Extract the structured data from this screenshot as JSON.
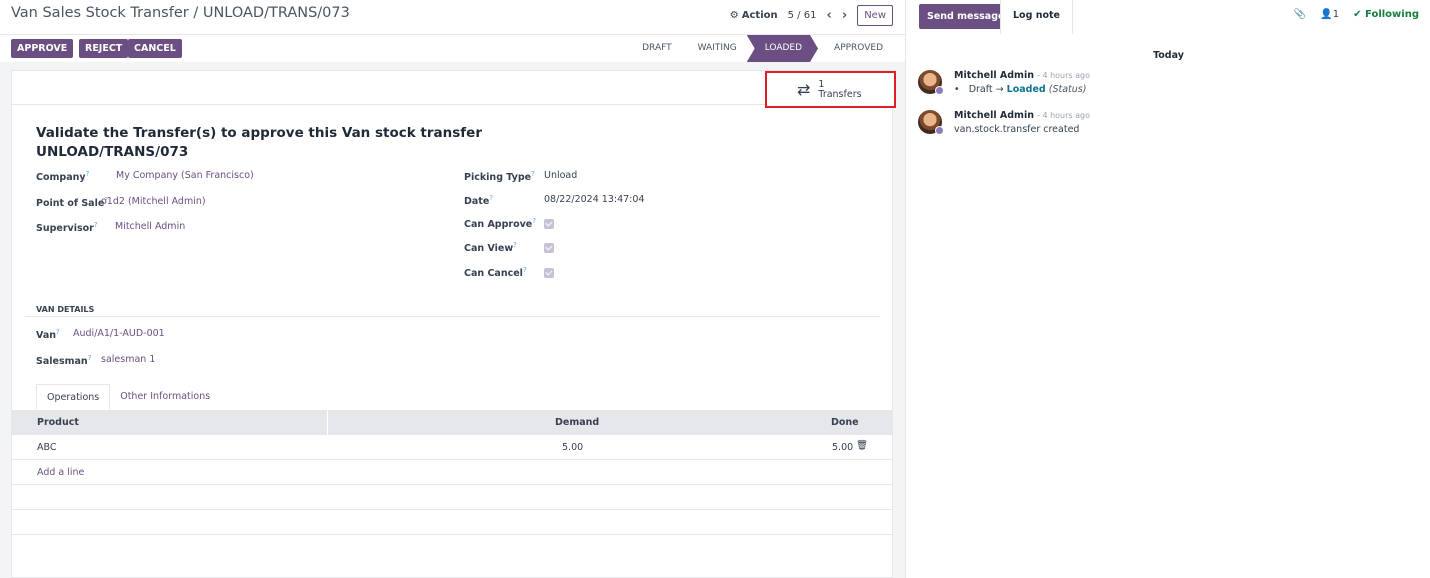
{
  "breadcrumb": "Van Sales Stock Transfer / UNLOAD/TRANS/073",
  "pager": {
    "action_label": "Action",
    "value": "5 / 61",
    "new_label": "New"
  },
  "actions": {
    "approve": "APPROVE",
    "reject": "REJECT",
    "cancel": "CANCEL"
  },
  "statusbar": {
    "stages": [
      "DRAFT",
      "WAITING",
      "LOADED",
      "APPROVED"
    ],
    "active": "LOADED"
  },
  "smart_button": {
    "count": "1",
    "label": "Transfers",
    "icon": "transfer-arrows-icon"
  },
  "form": {
    "title_line1": "Validate the Transfer(s) to approve this Van stock transfer",
    "title_line2": "UNLOAD/TRANS/073",
    "left_fields": [
      {
        "label": "Company",
        "value": "My Company (San Francisco)"
      },
      {
        "label": "Point of Sale",
        "value": "o1d2 (Mitchell Admin)"
      },
      {
        "label": "Supervisor",
        "value": "Mitchell Admin"
      }
    ],
    "right_fields": [
      {
        "label": "Picking Type",
        "value": "Unload"
      },
      {
        "label": "Date",
        "value": "08/22/2024 13:47:04"
      },
      {
        "label": "Can Approve",
        "checked": true
      },
      {
        "label": "Can View",
        "checked": true
      },
      {
        "label": "Can Cancel",
        "checked": true
      }
    ],
    "van_section": "VAN DETAILS",
    "van_fields": [
      {
        "label": "Van",
        "value": "Audi/A1/1-AUD-001"
      },
      {
        "label": "Salesman",
        "value": "salesman 1"
      }
    ],
    "tooltip_mark": "?"
  },
  "tabs": [
    "Operations",
    "Other Informations"
  ],
  "table": {
    "headers": {
      "product": "Product",
      "demand": "Demand",
      "done": "Done"
    },
    "rows": [
      {
        "product": "ABC",
        "demand": "5.00",
        "done": "5.00"
      }
    ],
    "add_line": "Add a line"
  },
  "chatter": {
    "send_message": "Send message",
    "log_note": "Log note",
    "followers_count": "1",
    "following": "Following",
    "date_separator": "Today",
    "messages": [
      {
        "author": "Mitchell Admin",
        "ago": "- 4 hours ago",
        "from": "Draft",
        "arrow": "→",
        "to": "Loaded",
        "field": "(Status)"
      },
      {
        "author": "Mitchell Admin",
        "ago": "- 4 hours ago",
        "body": "van.stock.transfer created"
      }
    ]
  },
  "colors": {
    "primary": "#6b4f82",
    "highlight": "#e11d25",
    "following": "#15803d"
  }
}
